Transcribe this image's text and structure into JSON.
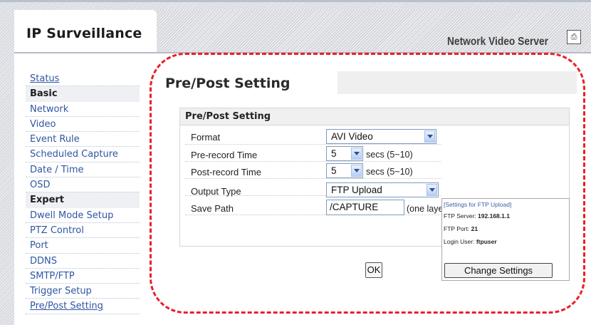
{
  "header": {
    "title": "IP Surveillance",
    "product": "Network Video Server"
  },
  "sidebar": {
    "status": "Status",
    "basic_header": "Basic",
    "basic_items": [
      "Network",
      "Video",
      "Event Rule",
      "Scheduled Capture",
      "Date / Time",
      "OSD"
    ],
    "expert_header": "Expert",
    "expert_items": [
      "Dwell Mode Setup",
      "PTZ Control",
      "Port",
      "DDNS",
      "SMTP/FTP",
      "Trigger Setup",
      "Pre/Post Setting"
    ]
  },
  "page": {
    "title": "Pre/Post Setting",
    "panel_title": "Pre/Post Setting"
  },
  "form": {
    "format_label": "Format",
    "format_value": "AVI Video",
    "pre_label": "Pre-record Time",
    "pre_value": "5",
    "pre_unit": "secs (5~10)",
    "post_label": "Post-record Time",
    "post_value": "5",
    "post_unit": "secs (5~10)",
    "output_label": "Output Type",
    "output_value": "FTP Upload",
    "save_label": "Save Path",
    "save_value": "/CAPTURE",
    "save_hint": "(one layer",
    "ok_label": "OK"
  },
  "ftp": {
    "title": "[Settings for FTP Upload]",
    "server_label": "FTP Server:",
    "server_value": "192.168.1.1",
    "port_label": "FTP Port:",
    "port_value": "21",
    "user_label": "Login User:",
    "user_value": "ftpuser",
    "change_label": "Change Settings"
  },
  "colors": {
    "link": "#2f56a3",
    "highlight": "#e8202a"
  }
}
